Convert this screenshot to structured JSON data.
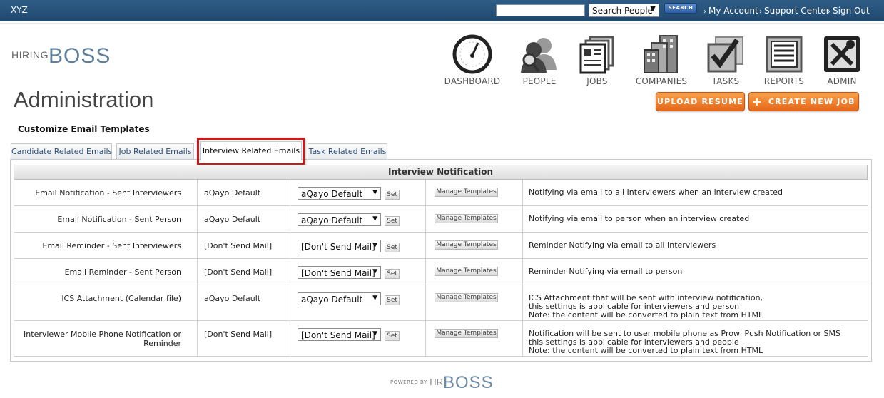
{
  "topbar": {
    "org_name": "XYZ",
    "search_value": "",
    "search_scope": "Search People",
    "search_button": "SEARCH",
    "links": [
      "My Account",
      "Support Center",
      "Sign Out"
    ]
  },
  "logo": {
    "small": "HIRING",
    "big": "BOSS"
  },
  "nav": [
    {
      "label": "DASHBOARD",
      "icon": "dashboard-gauge-icon"
    },
    {
      "label": "PEOPLE",
      "icon": "people-icon"
    },
    {
      "label": "JOBS",
      "icon": "jobs-cards-icon"
    },
    {
      "label": "COMPANIES",
      "icon": "companies-buildings-icon"
    },
    {
      "label": "TASKS",
      "icon": "tasks-checkmark-icon"
    },
    {
      "label": "REPORTS",
      "icon": "reports-document-icon"
    },
    {
      "label": "ADMIN",
      "icon": "admin-tools-icon"
    }
  ],
  "page_title": "Administration",
  "section_title": "Customize Email Templates",
  "actions": {
    "upload_resume": "UPLOAD RESUME",
    "create_new_job": "CREATE NEW JOB"
  },
  "tabs": [
    {
      "label": "Candidate Related Emails",
      "active": false
    },
    {
      "label": "Job Related Emails",
      "active": false
    },
    {
      "label": "Interview Related Emails",
      "active": true
    },
    {
      "label": "Task Related Emails",
      "active": false
    }
  ],
  "table": {
    "heading": "Interview Notification",
    "set_label": "Set",
    "manage_label": "Manage Templates",
    "rows": [
      {
        "name": "Email Notification - Sent Interviewers",
        "current": "aQayo Default",
        "selected": "aQayo Default",
        "description": "Notifying via email to all Interviewers when an interview created"
      },
      {
        "name": "Email Notification - Sent Person",
        "current": "aQayo Default",
        "selected": "aQayo Default",
        "description": "Notifying via email to person when an interview created"
      },
      {
        "name": "Email Reminder - Sent Interviewers",
        "current": "[Don't Send Mail]",
        "selected": "[Don't Send Mail]",
        "description": "Reminder Notifying via email to all Interviewers"
      },
      {
        "name": "Email Reminder - Sent Person",
        "current": "[Don't Send Mail]",
        "selected": "[Don't Send Mail]",
        "description": "Reminder Notifying via email to person"
      },
      {
        "name": "ICS Attachment (Calendar file)",
        "current": "aQayo Default",
        "selected": "aQayo Default",
        "description": "ICS Attachment that will be sent with interview notification,\nthis settings is applicable for interviewers and person\nNote: the content will be converted to plain text from HTML"
      },
      {
        "name": "Interviewer Mobile Phone Notification or Reminder",
        "current": "[Don't Send Mail]",
        "selected": "[Don't Send Mail]",
        "description": "Notification will be sent to user mobile phone as Prowl Push Notification or SMS\nthis settings is applicable for interviewers and people\nNote: the content will be converted to plain text from HTML"
      }
    ]
  },
  "footer": {
    "powered_by": "POWERED BY",
    "brand_small": "HR",
    "brand_big": "BOSS"
  },
  "colors": {
    "topbar": "#214a70",
    "accent_orange": "#e5681a",
    "highlight_red": "#d0181b",
    "tab_text": "#2f4f7a"
  }
}
